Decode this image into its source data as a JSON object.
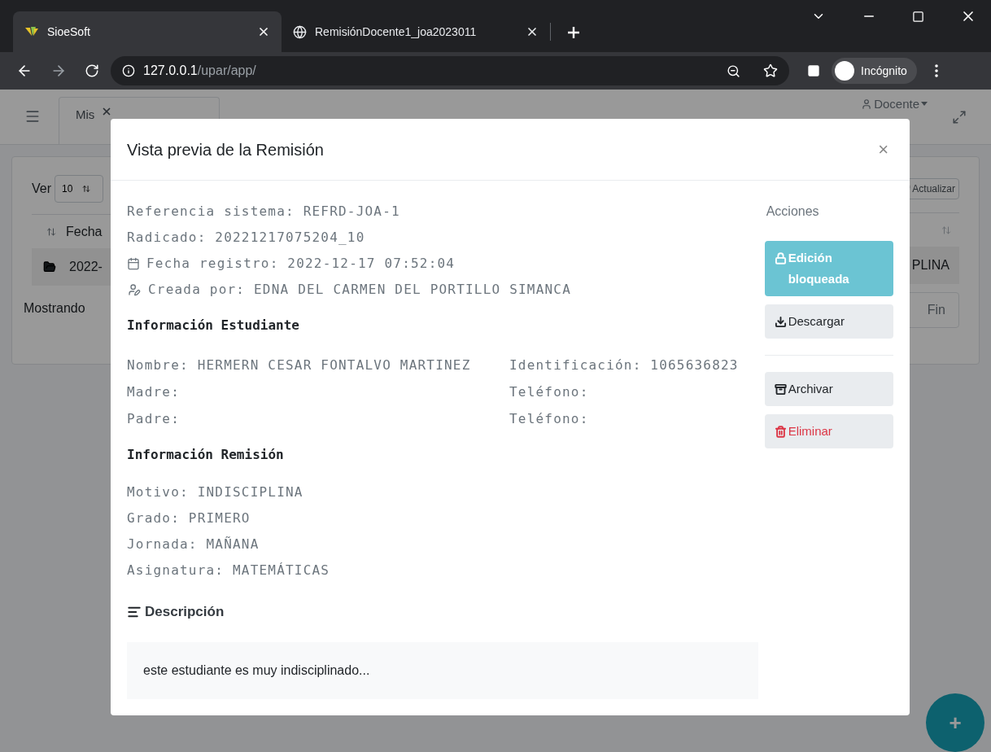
{
  "browser": {
    "tabs": [
      {
        "title": "SioeSoft",
        "selected": true
      },
      {
        "title": "RemisiónDocente1_joa2023011",
        "selected": false
      }
    ],
    "url_host": "127.0.0.1",
    "url_path": "/upar/app/",
    "profile": "Incógnito"
  },
  "app": {
    "nav_tab": "Mis",
    "user": "Docente",
    "ver_label": "Ver",
    "page_size": "10",
    "refresh": "Actualizar",
    "column": "Fecha",
    "row_date": "2022-",
    "row_end": "PLINA",
    "footer": "Mostrando",
    "last_page": "Fin"
  },
  "modal": {
    "title": "Vista previa de la Remisión",
    "close": "×",
    "meta": [
      {
        "kind": "plain",
        "text": "Referencia sistema: REFRD-JOA-1"
      },
      {
        "kind": "plain",
        "text": "Radicado: 20221217075204_10"
      },
      {
        "kind": "date",
        "text": "Fecha registro: 2022-12-17 07:52:04"
      },
      {
        "kind": "user",
        "text": "Creada por: EDNA DEL CARMEN DEL PORTILLO SIMANCA"
      }
    ],
    "student_heading": "Información Estudiante",
    "student_fields": [
      [
        "Nombre: HERMERN CESAR FONTALVO MARTINEZ",
        "Identificación: 1065636823"
      ],
      [
        "Madre:",
        "Teléfono:"
      ],
      [
        "Padre:",
        "Teléfono:"
      ]
    ],
    "referral_heading": "Información Remisión",
    "referral_fields": [
      "Motivo: INDISCIPLINA",
      "Grado: PRIMERO",
      "Jornada: MAÑANA",
      "Asignatura: MATEMÁTICAS"
    ],
    "description_heading": "Descripción",
    "description": "este estudiante es muy indisciplinado...",
    "actions_heading": "Acciones",
    "action_groups": [
      [
        {
          "kind": "locked",
          "label": "Edición bloqueada"
        },
        {
          "kind": "download",
          "label": "Descargar"
        }
      ],
      [
        {
          "kind": "archive",
          "label": "Archivar"
        },
        {
          "kind": "delete",
          "label": "Eliminar"
        }
      ]
    ]
  },
  "fab": "+"
}
